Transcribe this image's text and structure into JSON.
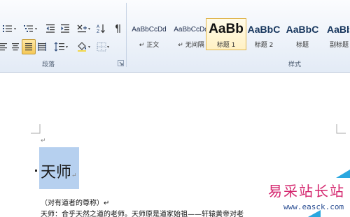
{
  "ribbon": {
    "paragraph_group_label": "段落",
    "styles_group_label": "样式",
    "styles": [
      {
        "sample": "AaBbCcDd",
        "name": "↵ 正文"
      },
      {
        "sample": "AaBbCcDd",
        "name": "↵ 无间隔"
      },
      {
        "sample": "AaBb",
        "name": "标题 1"
      },
      {
        "sample": "AaBbC",
        "name": "标题 2"
      },
      {
        "sample": "AaBbC",
        "name": "标题"
      },
      {
        "sample": "AaBbC",
        "name": "副标题"
      }
    ],
    "selected_style": "标题 1"
  },
  "document": {
    "empty_para_mark": "↵",
    "heading": "天师",
    "heading_mark": "↵",
    "line1": "（对有道者的尊称）↵",
    "line2": "天师：合乎天然之道的老师。天师原是道家始祖——轩辕黄帝对老"
  },
  "watermark": {
    "text": "易采站长站",
    "url": "www.easck.com"
  },
  "colors": {
    "selection": "#b6d0ef",
    "watermark_text": "#d4256d",
    "watermark_url": "#2c4f93",
    "active_button": "#f5c857"
  }
}
